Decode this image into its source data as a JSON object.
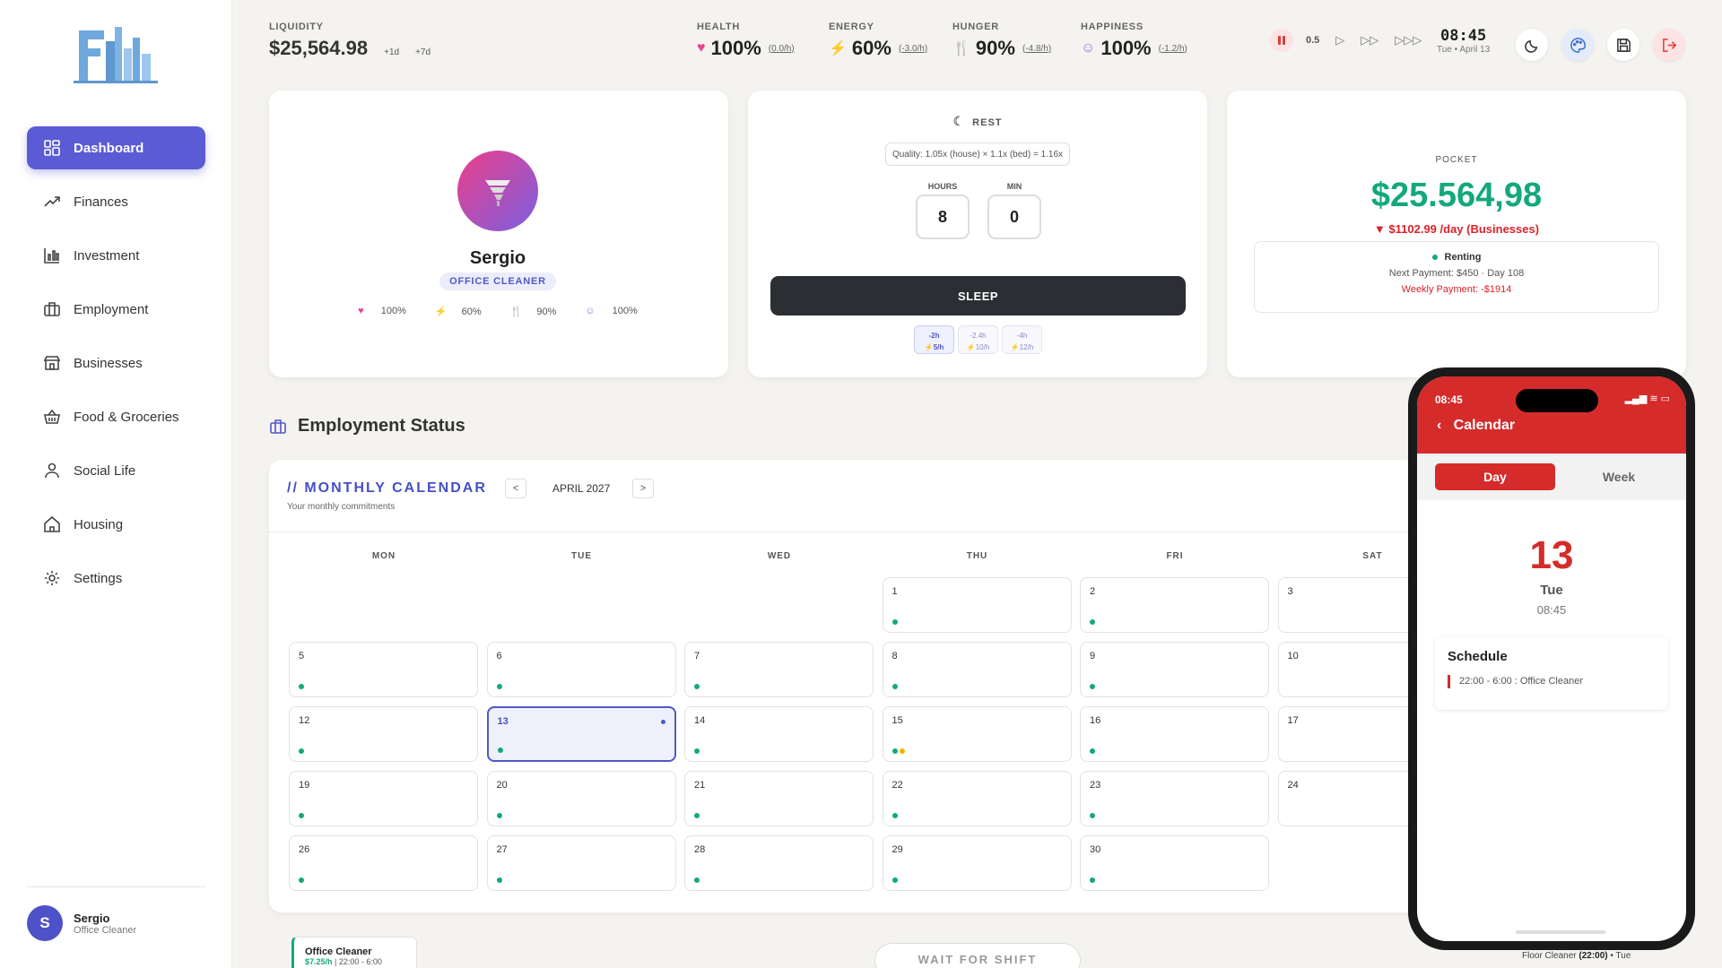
{
  "sidebar": {
    "items": [
      {
        "label": "Dashboard",
        "icon": "dashboard-icon"
      },
      {
        "label": "Finances",
        "icon": "trending-up-icon"
      },
      {
        "label": "Investment",
        "icon": "chart-icon"
      },
      {
        "label": "Employment",
        "icon": "briefcase-icon"
      },
      {
        "label": "Businesses",
        "icon": "store-icon"
      },
      {
        "label": "Food & Groceries",
        "icon": "basket-icon"
      },
      {
        "label": "Social Life",
        "icon": "person-icon"
      },
      {
        "label": "Housing",
        "icon": "home-icon"
      },
      {
        "label": "Settings",
        "icon": "gear-icon"
      }
    ],
    "user": {
      "initial": "S",
      "name": "Sergio",
      "role": "Office Cleaner"
    }
  },
  "top": {
    "liquidity": {
      "label": "LIQUIDITY",
      "value": "$25,564.98",
      "btn1": "+1d",
      "btn2": "+7d"
    },
    "health": {
      "label": "HEALTH",
      "value": "100%",
      "rate": "(0.0/h)",
      "color": "#e84393"
    },
    "energy": {
      "label": "ENERGY",
      "value": "60%",
      "rate": "(-3.0/h)",
      "color": "#f0b400"
    },
    "hunger": {
      "label": "HUNGER",
      "value": "90%",
      "rate": "(-4.8/h)",
      "color": "#9aa0e0"
    },
    "happiness": {
      "label": "HAPPINESS",
      "value": "100%",
      "rate": "(-1.2/h)",
      "color": "#9b6fe0"
    },
    "speed": "0.5",
    "clock": {
      "time": "08:45",
      "date": "Tue • April 13"
    }
  },
  "profile": {
    "name": "Sergio",
    "job": "OFFICE CLEANER",
    "stats": {
      "health": "100%",
      "energy": "60%",
      "hunger": "90%",
      "happiness": "100%"
    }
  },
  "rest": {
    "title": "REST",
    "quality": "Quality: 1.05x (house) × 1.1x (bed) = 1.16x",
    "hours_label": "HOURS",
    "min_label": "MIN",
    "hours": "8",
    "minutes": "0",
    "sleep_label": "SLEEP",
    "speeds": [
      {
        "top": "-2h",
        "bottom": "⚡5/h"
      },
      {
        "top": "-2.4h",
        "bottom": "⚡10/h"
      },
      {
        "top": "-4h",
        "bottom": "⚡12/h"
      }
    ]
  },
  "pocket": {
    "label": "POCKET",
    "value": "$25.564,98",
    "rate": "▼ $1102.99 /day (Businesses)",
    "status": "Renting",
    "next": "Next Payment: $450 · Day 108",
    "weekly": "Weekly Payment: -$1914"
  },
  "employment": {
    "title": "Employment Status"
  },
  "calendar": {
    "title": "// MONTHLY CALENDAR",
    "subtitle": "Your monthly commitments",
    "month": "APRIL 2027",
    "prev": "<",
    "next": ">",
    "dows": [
      "MON",
      "TUE",
      "WED",
      "THU",
      "FRI",
      "SAT"
    ],
    "days": [
      {
        "n": "1",
        "col": 3,
        "row": 0,
        "dots": [
          "#13a87d"
        ]
      },
      {
        "n": "2",
        "col": 4,
        "row": 0,
        "dots": [
          "#13a87d"
        ]
      },
      {
        "n": "3",
        "col": 5,
        "row": 0,
        "dots": []
      },
      {
        "n": "5",
        "col": 0,
        "row": 1,
        "dots": [
          "#13a87d"
        ]
      },
      {
        "n": "6",
        "col": 1,
        "row": 1,
        "dots": [
          "#13a87d"
        ]
      },
      {
        "n": "7",
        "col": 2,
        "row": 1,
        "dots": [
          "#13a87d"
        ]
      },
      {
        "n": "8",
        "col": 3,
        "row": 1,
        "dots": [
          "#13a87d"
        ]
      },
      {
        "n": "9",
        "col": 4,
        "row": 1,
        "dots": [
          "#13a87d"
        ]
      },
      {
        "n": "10",
        "col": 5,
        "row": 1,
        "dots": []
      },
      {
        "n": "12",
        "col": 0,
        "row": 2,
        "dots": [
          "#13a87d"
        ]
      },
      {
        "n": "13",
        "col": 1,
        "row": 2,
        "dots": [
          "#13a87d"
        ],
        "today": true
      },
      {
        "n": "14",
        "col": 2,
        "row": 2,
        "dots": [
          "#13a87d"
        ]
      },
      {
        "n": "15",
        "col": 3,
        "row": 2,
        "dots": [
          "#13a87d",
          "#f0b400"
        ]
      },
      {
        "n": "16",
        "col": 4,
        "row": 2,
        "dots": [
          "#13a87d"
        ]
      },
      {
        "n": "17",
        "col": 5,
        "row": 2,
        "dots": []
      },
      {
        "n": "19",
        "col": 0,
        "row": 3,
        "dots": [
          "#13a87d"
        ]
      },
      {
        "n": "20",
        "col": 1,
        "row": 3,
        "dots": [
          "#13a87d"
        ]
      },
      {
        "n": "21",
        "col": 2,
        "row": 3,
        "dots": [
          "#13a87d"
        ]
      },
      {
        "n": "22",
        "col": 3,
        "row": 3,
        "dots": [
          "#13a87d"
        ]
      },
      {
        "n": "23",
        "col": 4,
        "row": 3,
        "dots": [
          "#13a87d"
        ]
      },
      {
        "n": "24",
        "col": 5,
        "row": 3,
        "dots": []
      },
      {
        "n": "26",
        "col": 0,
        "row": 4,
        "dots": [
          "#13a87d"
        ]
      },
      {
        "n": "27",
        "col": 1,
        "row": 4,
        "dots": [
          "#13a87d"
        ]
      },
      {
        "n": "28",
        "col": 2,
        "row": 4,
        "dots": [
          "#13a87d"
        ]
      },
      {
        "n": "29",
        "col": 3,
        "row": 4,
        "dots": [
          "#13a87d"
        ]
      },
      {
        "n": "30",
        "col": 4,
        "row": 4,
        "dots": [
          "#13a87d"
        ]
      }
    ]
  },
  "shift": {
    "name": "Office Cleaner",
    "pay": "$7.25/h",
    "hours": "22:00 - 6:00"
  },
  "wait_label": "WAIT FOR SHIFT",
  "footer_note": {
    "job": "Floor Cleaner",
    "time": "(22:00)",
    "day": "Tue"
  },
  "phone": {
    "time": "08:45",
    "title": "Calendar",
    "tab_day": "Day",
    "tab_week": "Week",
    "day_num": "13",
    "dow": "Tue",
    "clock": "08:45",
    "schedule_title": "Schedule",
    "schedule_item": "22:00 - 6:00 : Office Cleaner"
  }
}
